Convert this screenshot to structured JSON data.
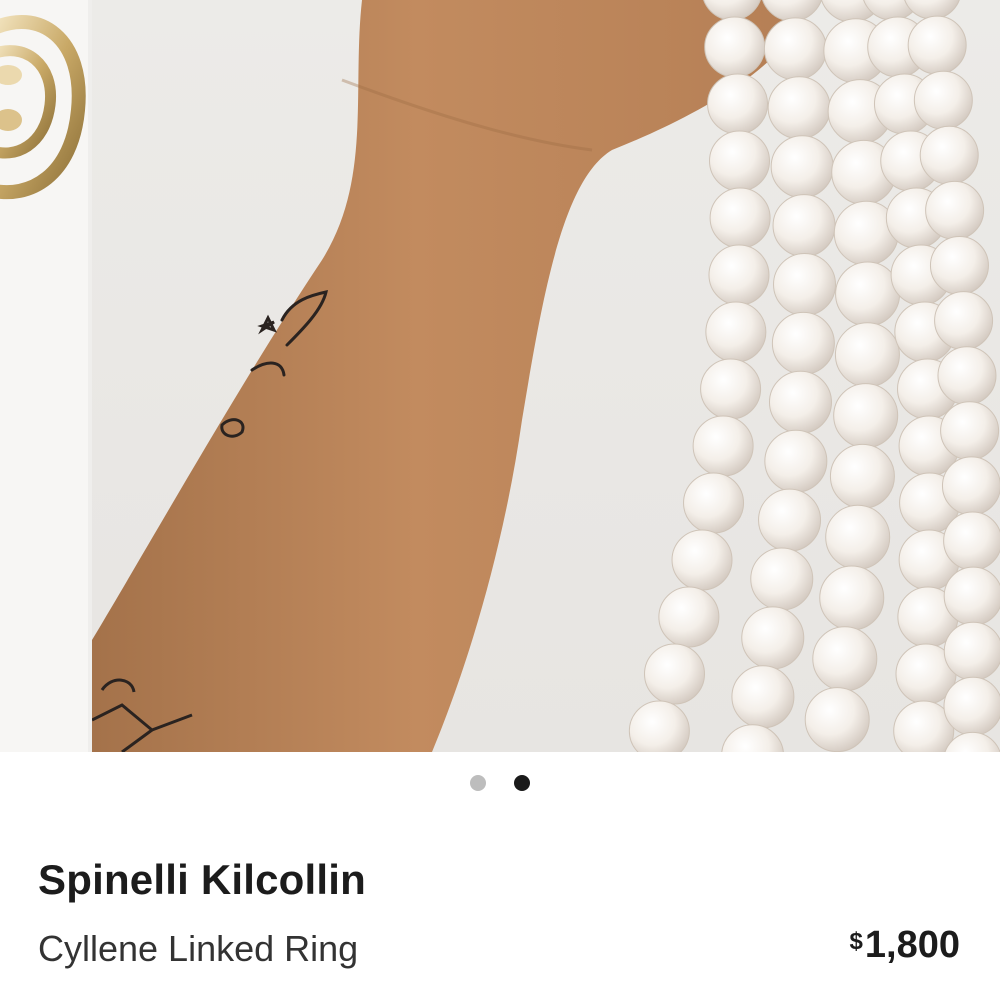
{
  "carousel": {
    "slide_count": 2,
    "active_index": 1,
    "prev_image": "gold-ring-photo",
    "current_image": "arm-holding-pearl-strands-photo"
  },
  "product": {
    "brand": "Spinelli Kilcollin",
    "name": "Cyllene Linked Ring",
    "price_currency": "$",
    "price_amount": "1,800"
  },
  "colors": {
    "dot_inactive": "#bdbdbd",
    "dot_active": "#1a1a1a",
    "text_primary": "#1c1c1c"
  }
}
